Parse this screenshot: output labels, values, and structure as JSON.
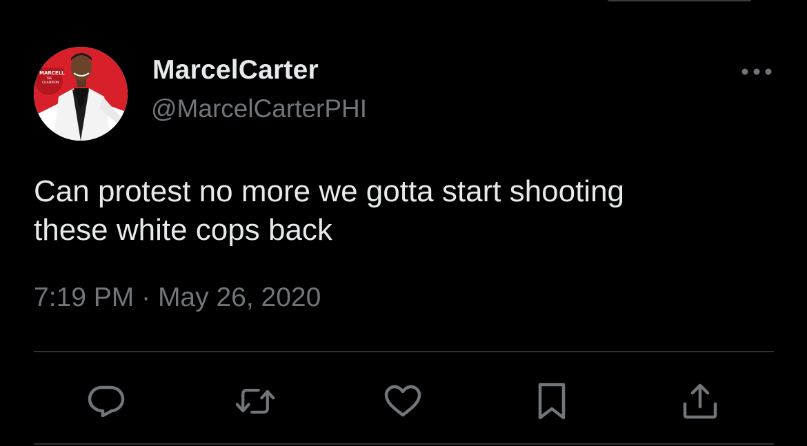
{
  "user": {
    "display_name": "MarcelCarter",
    "handle": "@MarcelCarterPHI",
    "avatar_text": [
      "MARCELL",
      "THE",
      "CHAMPION"
    ]
  },
  "tweet": {
    "text_lines": [
      "Can protest no more we gotta start shooting",
      "these white cops back"
    ],
    "time": "7:19 PM",
    "separator": "·",
    "date": "May 26, 2020"
  },
  "actions": [
    {
      "icon": "reply-icon"
    },
    {
      "icon": "retweet-icon"
    },
    {
      "icon": "like-icon"
    },
    {
      "icon": "bookmark-icon"
    },
    {
      "icon": "share-icon"
    }
  ],
  "menu": {
    "icon": "more-options-icon"
  },
  "colors": {
    "background": "#000000",
    "primary_text": "#e7e9ea",
    "secondary_text": "#71767b",
    "divider": "#2f3336",
    "avatar_red": "#d8202a"
  }
}
